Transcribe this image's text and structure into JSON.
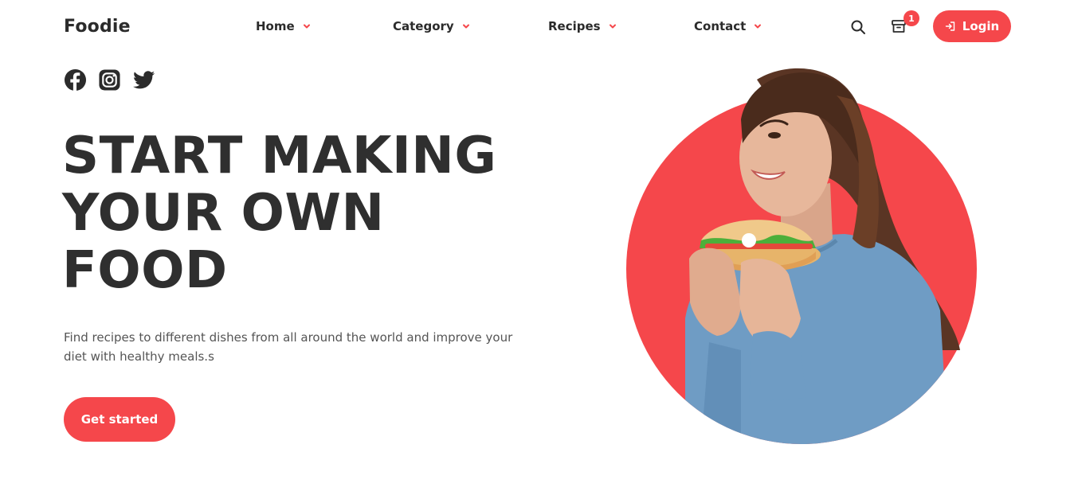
{
  "brand": {
    "name": "Foodie"
  },
  "nav": {
    "items": [
      {
        "label": "Home"
      },
      {
        "label": "Category"
      },
      {
        "label": "Recipes"
      },
      {
        "label": "Contact"
      }
    ]
  },
  "header": {
    "cart_count": "1",
    "login_label": "Login"
  },
  "icons": {
    "search": "search-icon",
    "cart": "archive-box-icon",
    "login": "sign-in-icon",
    "socials": [
      "facebook-icon",
      "instagram-icon",
      "twitter-icon"
    ]
  },
  "hero": {
    "headline_lines": [
      "START MAKING",
      "YOUR OWN",
      "FOOD"
    ],
    "subtitle": "Find recipes to different dishes from all around the world and improve your diet with healthy meals.s",
    "cta_label": "Get started"
  },
  "colors": {
    "accent": "#f5474b",
    "text_dark": "#2b2b2b",
    "text_muted": "#555555",
    "sweater": "#6f9cc4"
  }
}
